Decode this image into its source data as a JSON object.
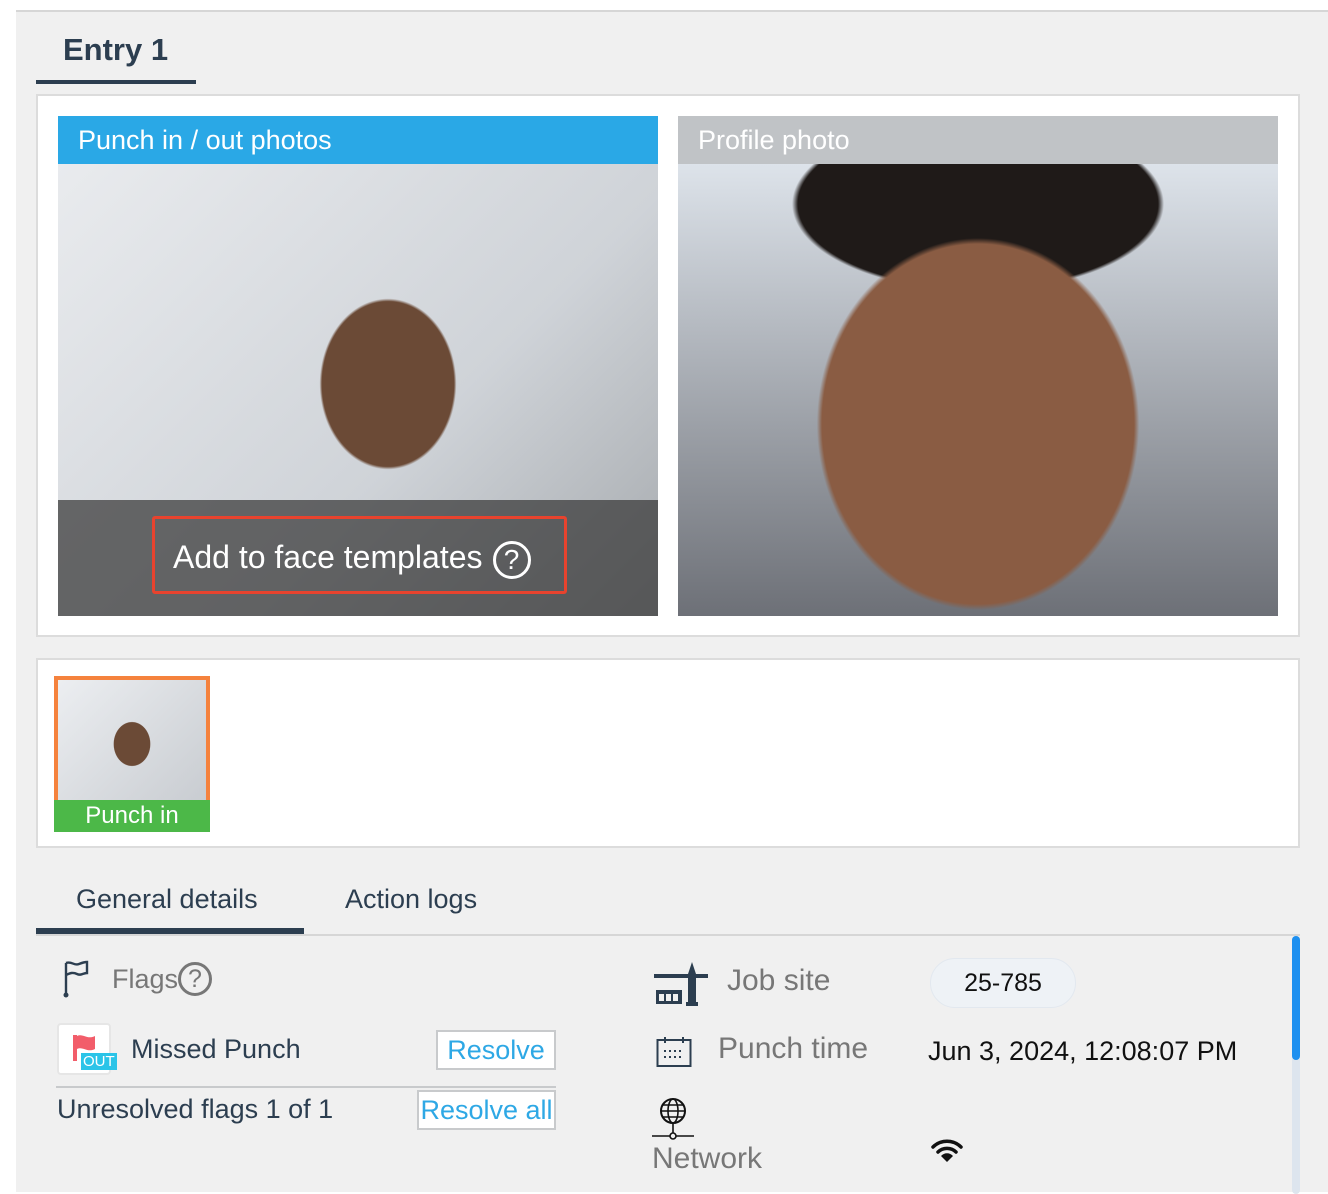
{
  "entry_title": "Entry 1",
  "photos": {
    "punch_header": "Punch in / out photos",
    "profile_header": "Profile photo",
    "add_to_templates": "Add to face templates",
    "punch_header_color": "#2aa8e6",
    "profile_header_color": "#c0c3c6"
  },
  "thumbnail": {
    "label": "Punch in",
    "border_color": "#f5823d",
    "label_color": "#4cb848"
  },
  "tabs": [
    {
      "label": "General details",
      "active": true
    },
    {
      "label": "Action logs",
      "active": false
    }
  ],
  "flags": {
    "title": "Flags",
    "items": [
      {
        "name": "Missed Punch",
        "badge": "OUT",
        "action": "Resolve"
      }
    ],
    "summary": "Unresolved flags 1 of 1",
    "resolve_all": "Resolve all"
  },
  "details": {
    "job_site_label": "Job site",
    "job_site_value": "25-785",
    "punch_time_label": "Punch time",
    "punch_time_value": "Jun 3, 2024, 12:08:07 PM",
    "network_label": "Network",
    "network_icon": "wifi-icon"
  }
}
